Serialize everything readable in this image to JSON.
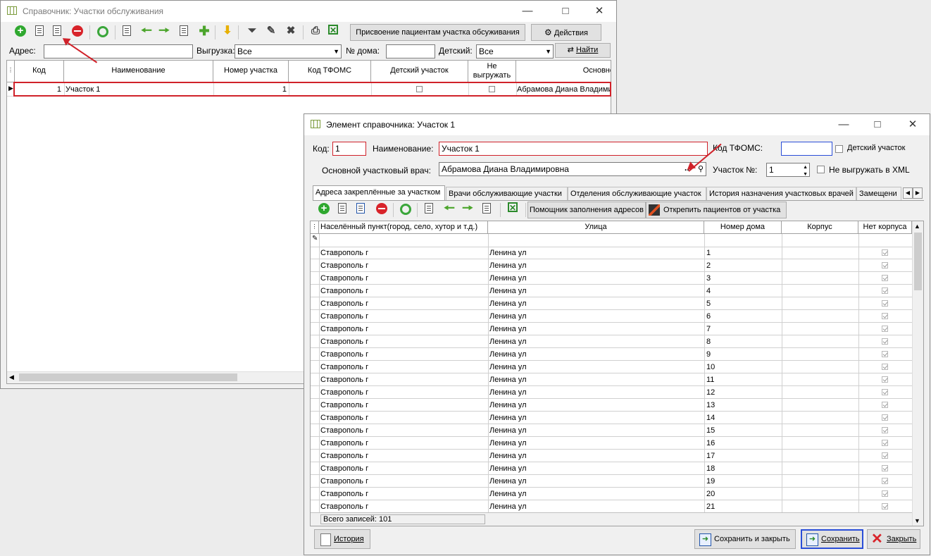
{
  "main_window": {
    "title": "Справочник: Участки обслуживания",
    "assign_button": "Присвоение пациентам участка обсуживания",
    "actions_button": "Действия",
    "filters": {
      "address_label": "Адрес:",
      "address_value": "",
      "export_label": "Выгрузка:",
      "export_value": "Все",
      "house_label": "№ дома:",
      "house_value": "",
      "kids_label": "Детский:",
      "kids_value": "Все",
      "find_button": "Найти"
    },
    "grid": {
      "headers": [
        "Код",
        "Наименование",
        "Номер участка",
        "Код ТФОМС",
        "Детский участок",
        "Не выгружать",
        "Основно"
      ],
      "rows": [
        {
          "code": "1",
          "name": "Участок 1",
          "number": "1",
          "tfoms": "",
          "kids": false,
          "no_export": false,
          "doctor": "Абрамова Диана Владимир"
        }
      ]
    }
  },
  "element_window": {
    "title": "Элемент справочника: Участок 1",
    "code_label": "Код:",
    "code_value": "1",
    "name_label": "Наименование:",
    "name_value": "Участок 1",
    "tfoms_label": "Код ТФОМС:",
    "tfoms_value": "",
    "kids_label": "Детский участок",
    "kids_checked": false,
    "doctor_label": "Основной участковый врач:",
    "doctor_value": "Абрамова Диана Владимировна",
    "doctor_dots": "...",
    "area_label": "Участок №:",
    "area_value": "1",
    "no_xml_label": "Не выгружать в XML",
    "no_xml_checked": false,
    "tabs": [
      "Адреса закреплённые за участком",
      "Врачи обслуживающие участки",
      "Отделения обслуживающие участок",
      "История назначения участковых врачей",
      "Замещени"
    ],
    "helper_button": "Помощник заполнения адресов",
    "detach_button": "Открепить пациентов от участка",
    "grid": {
      "headers": [
        "Населённый пункт(город, село, хутор и т.д.)",
        "Улица",
        "Номер дома",
        "Корпус",
        "Нет корпуса"
      ],
      "rows": [
        {
          "city": "Ставрополь г",
          "street": "Ленина ул",
          "house": "1",
          "korpus": "",
          "no_korpus": true
        },
        {
          "city": "Ставрополь г",
          "street": "Ленина ул",
          "house": "2",
          "korpus": "",
          "no_korpus": true
        },
        {
          "city": "Ставрополь г",
          "street": "Ленина ул",
          "house": "3",
          "korpus": "",
          "no_korpus": true
        },
        {
          "city": "Ставрополь г",
          "street": "Ленина ул",
          "house": "4",
          "korpus": "",
          "no_korpus": true
        },
        {
          "city": "Ставрополь г",
          "street": "Ленина ул",
          "house": "5",
          "korpus": "",
          "no_korpus": true
        },
        {
          "city": "Ставрополь г",
          "street": "Ленина ул",
          "house": "6",
          "korpus": "",
          "no_korpus": true
        },
        {
          "city": "Ставрополь г",
          "street": "Ленина ул",
          "house": "7",
          "korpus": "",
          "no_korpus": true
        },
        {
          "city": "Ставрополь г",
          "street": "Ленина ул",
          "house": "8",
          "korpus": "",
          "no_korpus": true
        },
        {
          "city": "Ставрополь г",
          "street": "Ленина ул",
          "house": "9",
          "korpus": "",
          "no_korpus": true
        },
        {
          "city": "Ставрополь г",
          "street": "Ленина ул",
          "house": "10",
          "korpus": "",
          "no_korpus": true
        },
        {
          "city": "Ставрополь г",
          "street": "Ленина ул",
          "house": "11",
          "korpus": "",
          "no_korpus": true
        },
        {
          "city": "Ставрополь г",
          "street": "Ленина ул",
          "house": "12",
          "korpus": "",
          "no_korpus": true
        },
        {
          "city": "Ставрополь г",
          "street": "Ленина ул",
          "house": "13",
          "korpus": "",
          "no_korpus": true
        },
        {
          "city": "Ставрополь г",
          "street": "Ленина ул",
          "house": "14",
          "korpus": "",
          "no_korpus": true
        },
        {
          "city": "Ставрополь г",
          "street": "Ленина ул",
          "house": "15",
          "korpus": "",
          "no_korpus": true
        },
        {
          "city": "Ставрополь г",
          "street": "Ленина ул",
          "house": "16",
          "korpus": "",
          "no_korpus": true
        },
        {
          "city": "Ставрополь г",
          "street": "Ленина ул",
          "house": "17",
          "korpus": "",
          "no_korpus": true
        },
        {
          "city": "Ставрополь г",
          "street": "Ленина ул",
          "house": "18",
          "korpus": "",
          "no_korpus": true
        },
        {
          "city": "Ставрополь г",
          "street": "Ленина ул",
          "house": "19",
          "korpus": "",
          "no_korpus": true
        },
        {
          "city": "Ставрополь г",
          "street": "Ленина ул",
          "house": "20",
          "korpus": "",
          "no_korpus": true
        },
        {
          "city": "Ставрополь г",
          "street": "Ленина ул",
          "house": "21",
          "korpus": "",
          "no_korpus": true
        }
      ]
    },
    "total_records": "Всего записей: 101",
    "history_button": "История",
    "save_close_button": "Сохранить и закрыть",
    "save_button": "Сохранить",
    "close_button": "Закрыть"
  },
  "colors": {
    "highlight_red": "#d0222a",
    "accent_green": "#2fa82f"
  }
}
